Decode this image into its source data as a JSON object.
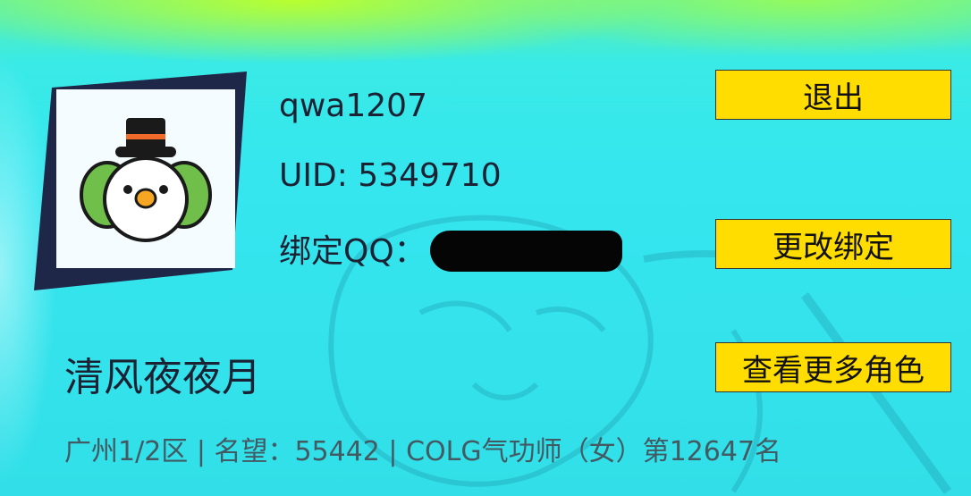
{
  "account": {
    "username": "qwa1207",
    "uid_label": "UID: ",
    "uid": "5349710",
    "bind_qq_label": "绑定QQ：",
    "bind_qq_value_redacted": true
  },
  "buttons": {
    "logout": "退出",
    "change_binding": "更改绑定",
    "more_roles": "查看更多角色"
  },
  "role": {
    "name": "清风夜夜月",
    "meta": "广州1/2区 | 名望：55442 | COLG气功师（女）第12647名"
  },
  "icons": {
    "avatar": "snowman-avatar-icon"
  },
  "colors": {
    "background": "#35e8ef",
    "button": "#ffdd00",
    "frame": "#1f2748",
    "text": "#1b2233"
  }
}
